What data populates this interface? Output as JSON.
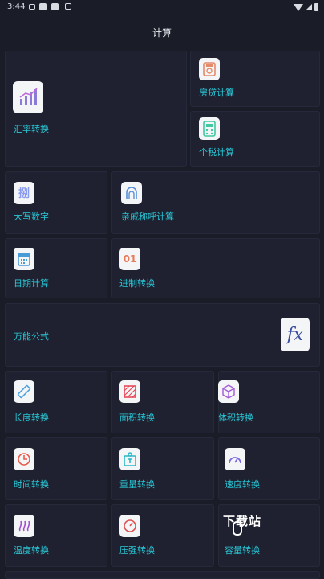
{
  "status_bar": {
    "time": "3:44"
  },
  "app_bar": {
    "title": "计算"
  },
  "tiles": {
    "exchange": {
      "label": "汇率转换",
      "icon": "chart-icon",
      "color": "#8b7ad8"
    },
    "mortgage": {
      "label": "房贷计算",
      "icon": "house-icon",
      "color": "#e58a6a"
    },
    "income_tax": {
      "label": "个税计算",
      "icon": "calculator-icon",
      "color": "#41c8a0"
    },
    "uppercase_number": {
      "label": "大写数字",
      "icon": "character-icon",
      "color": "#8b9cf0"
    },
    "relative_title": {
      "label": "亲戚称呼计算",
      "icon": "family-icon",
      "color": "#5a90d8"
    },
    "date_calc": {
      "label": "日期计算",
      "icon": "calendar-icon",
      "color": "#4a9ad8"
    },
    "base_convert": {
      "label": "进制转换",
      "icon": "binary-icon",
      "color": "#e87a5a"
    },
    "formula": {
      "label": "万能公式",
      "icon": "fx-icon",
      "icon_text": "fx",
      "color": "#3c4ea0"
    },
    "length": {
      "label": "长度转换",
      "icon": "ruler-icon",
      "color": "#4aa0e0"
    },
    "area": {
      "label": "面积转换",
      "icon": "area-icon",
      "color": "#e84a5a"
    },
    "volume": {
      "label": "体积转换",
      "icon": "cube-icon",
      "color": "#a35ad8"
    },
    "time": {
      "label": "时间转换",
      "icon": "clock-icon",
      "color": "#e85a4a"
    },
    "weight": {
      "label": "重量转换",
      "icon": "weight-icon",
      "color": "#2ab8c8"
    },
    "speed": {
      "label": "速度转换",
      "icon": "speedometer-icon",
      "color": "#7a6ae0"
    },
    "temperature": {
      "label": "温度转换",
      "icon": "temperature-icon",
      "color": "#a050d0"
    },
    "pressure": {
      "label": "压强转换",
      "icon": "gauge-icon",
      "color": "#e05050"
    },
    "capacity": {
      "label": "容量转换",
      "icon": "beaker-icon",
      "color": "#4aa0e0"
    }
  },
  "watermark": {
    "text": "下载站"
  }
}
